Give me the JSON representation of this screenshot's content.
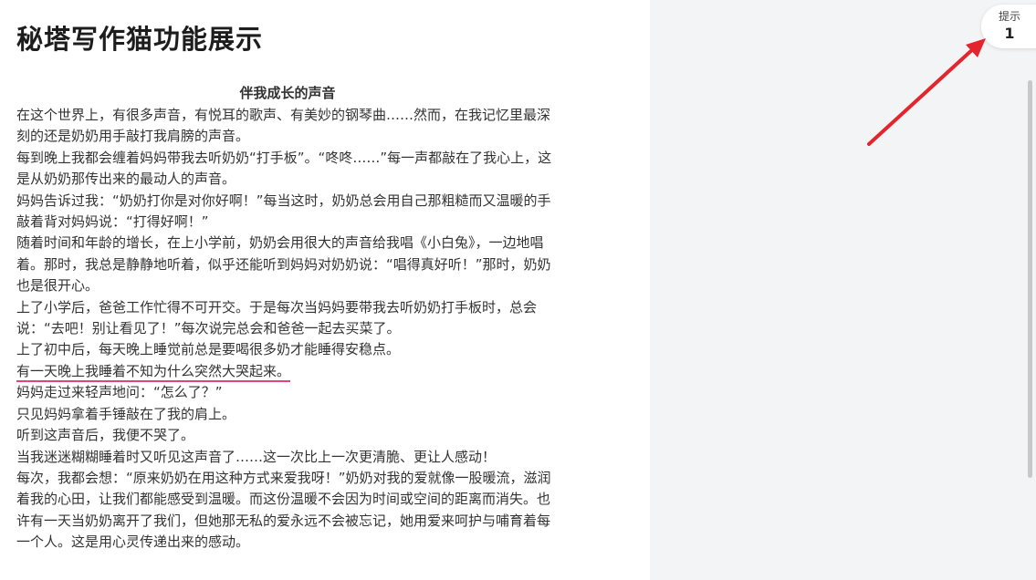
{
  "document": {
    "title": "秘塔写作猫功能展示",
    "essay_title": "伴我成长的声音",
    "paragraphs": [
      {
        "text": "在这个世界上，有很多声音，有悦耳的歌声、有美妙的钢琴曲……然而，在我记忆里最深刻的还是奶奶用手敲打我肩膀的声音。",
        "highlighted": false
      },
      {
        "text": "每到晚上我都会缠着妈妈带我去听奶奶“打手板”。“咚咚……”每一声都敲在了我心上，这是从奶奶那传出来的最动人的声音。",
        "highlighted": false
      },
      {
        "text": "妈妈告诉过我：“奶奶打你是对你好啊！”每当这时，奶奶总会用自己那粗糙而又温暖的手敲着背对妈妈说：“打得好啊！”",
        "highlighted": false
      },
      {
        "text": "随着时间和年龄的增长，在上小学前，奶奶会用很大的声音给我唱《小白兔》，一边地唱着。那时，我总是静静地听着，似乎还能听到妈妈对奶奶说：“唱得真好听！”那时，奶奶也是很开心。",
        "highlighted": false
      },
      {
        "text": "上了小学后，爸爸工作忙得不可开交。于是每次当妈妈要带我去听奶奶打手板时，总会说：“去吧！别让看见了！”每次说完总会和爸爸一起去买菜了。",
        "highlighted": false
      },
      {
        "text": "上了初中后，每天晚上睡觉前总是要喝很多奶才能睡得安稳点。",
        "highlighted": false
      },
      {
        "text": "有一天晚上我睡着不知为什么突然大哭起来。",
        "highlighted": true
      },
      {
        "text": "妈妈走过来轻声地问：“怎么了？”",
        "highlighted": false
      },
      {
        "text": "只见妈妈拿着手锤敲在了我的肩上。",
        "highlighted": false
      },
      {
        "text": "听到这声音后，我便不哭了。",
        "highlighted": false
      },
      {
        "text": "当我迷迷糊糊睡着时又听见这声音了……这一次比上一次更清脆、更让人感动！",
        "highlighted": false
      },
      {
        "text": "每次，我都会想：“原来奶奶在用这种方式来爱我呀！”奶奶对我的爱就像一股暖流，滋润着我的心田，让我们都能感受到温暖。而这份温暖不会因为时间或空间的距离而消失。也许有一天当奶奶离开了我们，但她那无私的爱永远不会被忘记，她用爱来呵护与哺育着每一个人。这是用心灵传递出来的感动。",
        "highlighted": false
      }
    ]
  },
  "hint": {
    "label": "提示",
    "count": "1"
  },
  "colors": {
    "highlight_underline": "#e0457a",
    "arrow": "#e3262e",
    "panel_bg": "#f3f4f6"
  }
}
